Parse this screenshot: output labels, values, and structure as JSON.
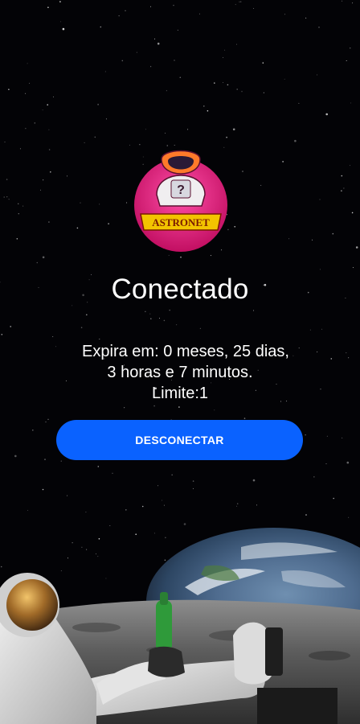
{
  "logo": {
    "icon": "astronaut-logo-icon",
    "brand_text": "ASTRONET",
    "brand_colors": {
      "circle": "#e0147a",
      "banner": "#f3c400",
      "banner_text": "#7a1a00"
    }
  },
  "status": {
    "label": "Conectado"
  },
  "expiry": {
    "line1": "Expira em: 0 meses, 25 dias,",
    "line2": "3 horas e 7 minutos.",
    "line3": "Limite:1"
  },
  "actions": {
    "disconnect_label": "DESCONECTAR",
    "accent_color": "#0a62ff"
  },
  "background": {
    "icon": "astronaut-on-moon-with-earth-illustration"
  }
}
